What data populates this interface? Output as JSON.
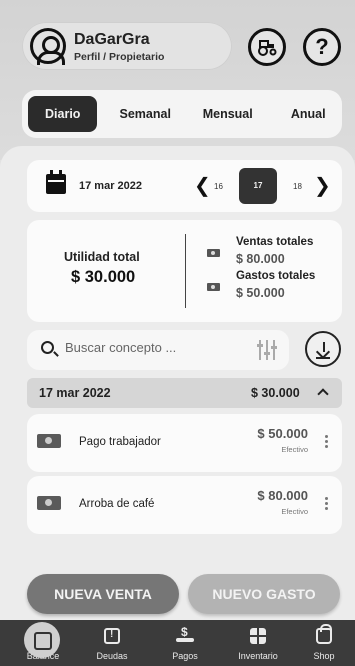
{
  "profile": {
    "name": "DaGarGra",
    "role": "Perfil / Propietario"
  },
  "header": {
    "help_label": "?"
  },
  "period_tabs": [
    {
      "label": "Diario",
      "active": true
    },
    {
      "label": "Semanal",
      "active": false
    },
    {
      "label": "Mensual",
      "active": false
    },
    {
      "label": "Anual",
      "active": false
    }
  ],
  "date_nav": {
    "date": "17 mar 2022",
    "prev_day": "16",
    "current_day": "17",
    "next_day": "18"
  },
  "summary": {
    "utility_label": "Utilidad total",
    "utility_value": "$ 30.000",
    "sales_label": "Ventas totales",
    "sales_value": "$ 80.000",
    "expenses_label": "Gastos totales",
    "expenses_value": "$ 50.000"
  },
  "search": {
    "placeholder": "Buscar concepto ..."
  },
  "group": {
    "date": "17 mar 2022",
    "total": "$ 30.000"
  },
  "transactions": [
    {
      "name": "Pago trabajador",
      "amount": "$ 50.000",
      "method": "Efectivo"
    },
    {
      "name": "Arroba de café",
      "amount": "$ 80.000",
      "method": "Efectivo"
    }
  ],
  "actions": {
    "new_sale": "NUEVA VENTA",
    "new_expense": "NUEVO GASTO"
  },
  "nav": {
    "items": [
      {
        "label": "Balance",
        "active": true
      },
      {
        "label": "Deudas",
        "active": false
      },
      {
        "label": "Pagos",
        "active": false
      },
      {
        "label": "Inventario",
        "active": false
      },
      {
        "label": "Shop",
        "active": false
      }
    ]
  },
  "colors": {
    "active_tab": "#2b2b2b",
    "primary_button": "#767676",
    "secondary_button": "#b3b3b3",
    "nav_bar": "#3b3b3b"
  }
}
